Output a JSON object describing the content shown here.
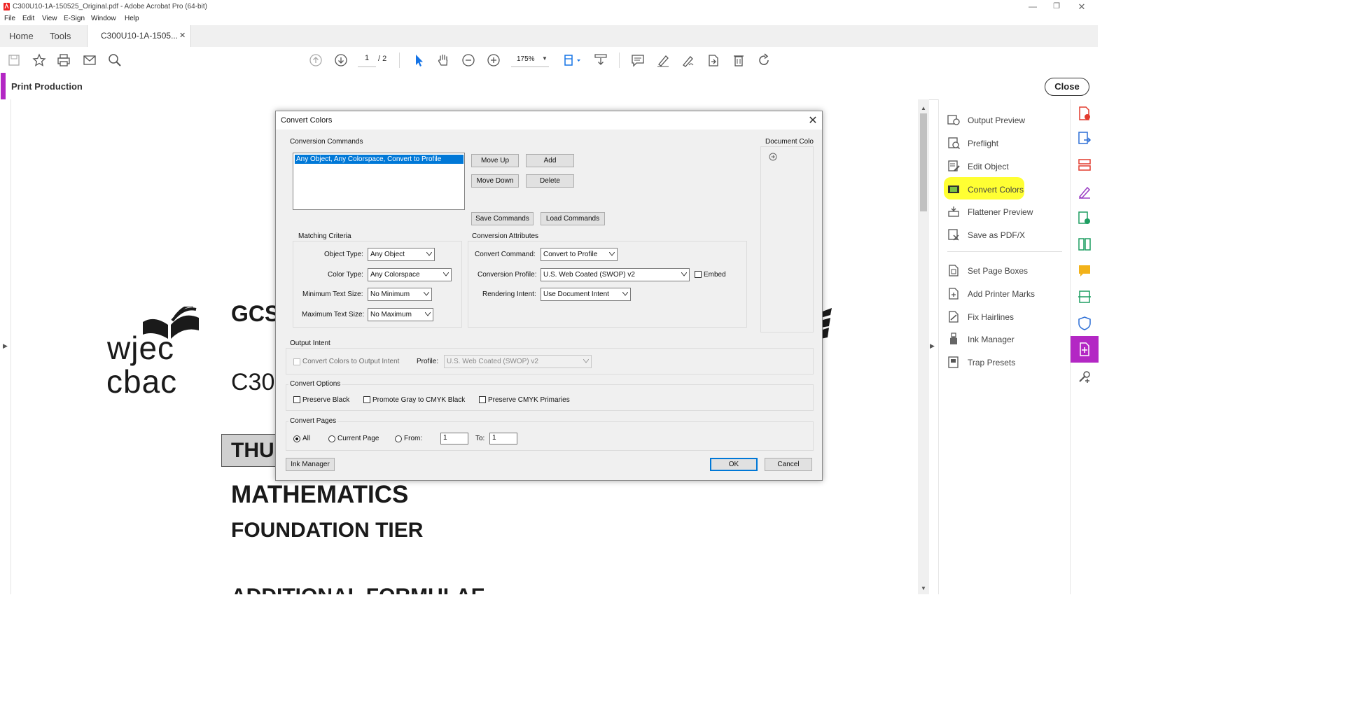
{
  "window": {
    "title": "C300U10-1A-150525_Original.pdf - Adobe Acrobat Pro (64-bit)"
  },
  "menu": [
    "File",
    "Edit",
    "View",
    "E-Sign",
    "Window",
    "Help"
  ],
  "tabs": {
    "home": "Home",
    "tools": "Tools",
    "document": "C300U10-1A-1505..."
  },
  "toolbar": {
    "page_current": "1",
    "page_total": "/ 2",
    "zoom": "175%"
  },
  "tool_bar": {
    "name": "Print Production",
    "close_label": "Close",
    "accent_color": "#b327c4"
  },
  "document": {
    "logo_line1": "wjec",
    "logo_line2": "cbac",
    "heading_fragment": "GCS",
    "code_fragment": "C30",
    "day_fragment": "THU",
    "subject": "MATHEMATICS",
    "tier": "FOUNDATION TIER",
    "bottom_fragment": "ADDITIONAL FORMULAE"
  },
  "right_panel": {
    "tools": [
      {
        "label": "Output Preview",
        "icon": "output-preview-icon"
      },
      {
        "label": "Preflight",
        "icon": "preflight-icon"
      },
      {
        "label": "Edit Object",
        "icon": "edit-object-icon"
      },
      {
        "label": "Convert Colors",
        "icon": "convert-colors-icon",
        "highlighted": true
      },
      {
        "label": "Flattener Preview",
        "icon": "flattener-preview-icon"
      },
      {
        "label": "Save as PDF/X",
        "icon": "save-pdfx-icon"
      },
      {
        "label": "Set Page Boxes",
        "icon": "set-page-boxes-icon"
      },
      {
        "label": "Add Printer Marks",
        "icon": "printer-marks-icon"
      },
      {
        "label": "Fix Hairlines",
        "icon": "fix-hairlines-icon"
      },
      {
        "label": "Ink Manager",
        "icon": "ink-manager-icon"
      },
      {
        "label": "Trap Presets",
        "icon": "trap-presets-icon"
      }
    ],
    "highlight_color": "#ffff33"
  },
  "dialog": {
    "title": "Convert Colors",
    "conversion_commands": {
      "label": "Conversion Commands",
      "items": [
        "Any Object, Any Colorspace, Convert to Profile"
      ],
      "move_up": "Move Up",
      "add": "Add",
      "move_down": "Move Down",
      "delete": "Delete",
      "save_commands": "Save Commands",
      "load_commands": "Load Commands"
    },
    "document_colors_label": "Document Colo",
    "matching_criteria": {
      "label": "Matching Criteria",
      "object_type_label": "Object Type:",
      "object_type": "Any Object",
      "color_type_label": "Color Type:",
      "color_type": "Any Colorspace",
      "min_text_label": "Minimum Text Size:",
      "min_text": "No Minimum",
      "max_text_label": "Maximum Text Size:",
      "max_text": "No Maximum"
    },
    "conversion_attributes": {
      "label": "Conversion Attributes",
      "command_label": "Convert Command:",
      "command": "Convert to Profile",
      "profile_label": "Conversion Profile:",
      "profile": "U.S. Web Coated (SWOP) v2",
      "embed_label": "Embed",
      "intent_label": "Rendering Intent:",
      "intent": "Use Document Intent"
    },
    "output_intent": {
      "label": "Output Intent",
      "convert_label": "Convert Colors to Output Intent",
      "profile_label": "Profile:",
      "profile": "U.S. Web Coated (SWOP) v2"
    },
    "convert_options": {
      "label": "Convert Options",
      "preserve_black": "Preserve Black",
      "promote_gray": "Promote Gray to CMYK Black",
      "preserve_cmyk": "Preserve CMYK Primaries"
    },
    "convert_pages": {
      "label": "Convert Pages",
      "all": "All",
      "current": "Current Page",
      "from_label": "From:",
      "from_value": "1",
      "to_label": "To:",
      "to_value": "1"
    },
    "ink_manager": "Ink Manager",
    "ok": "OK",
    "cancel": "Cancel"
  }
}
